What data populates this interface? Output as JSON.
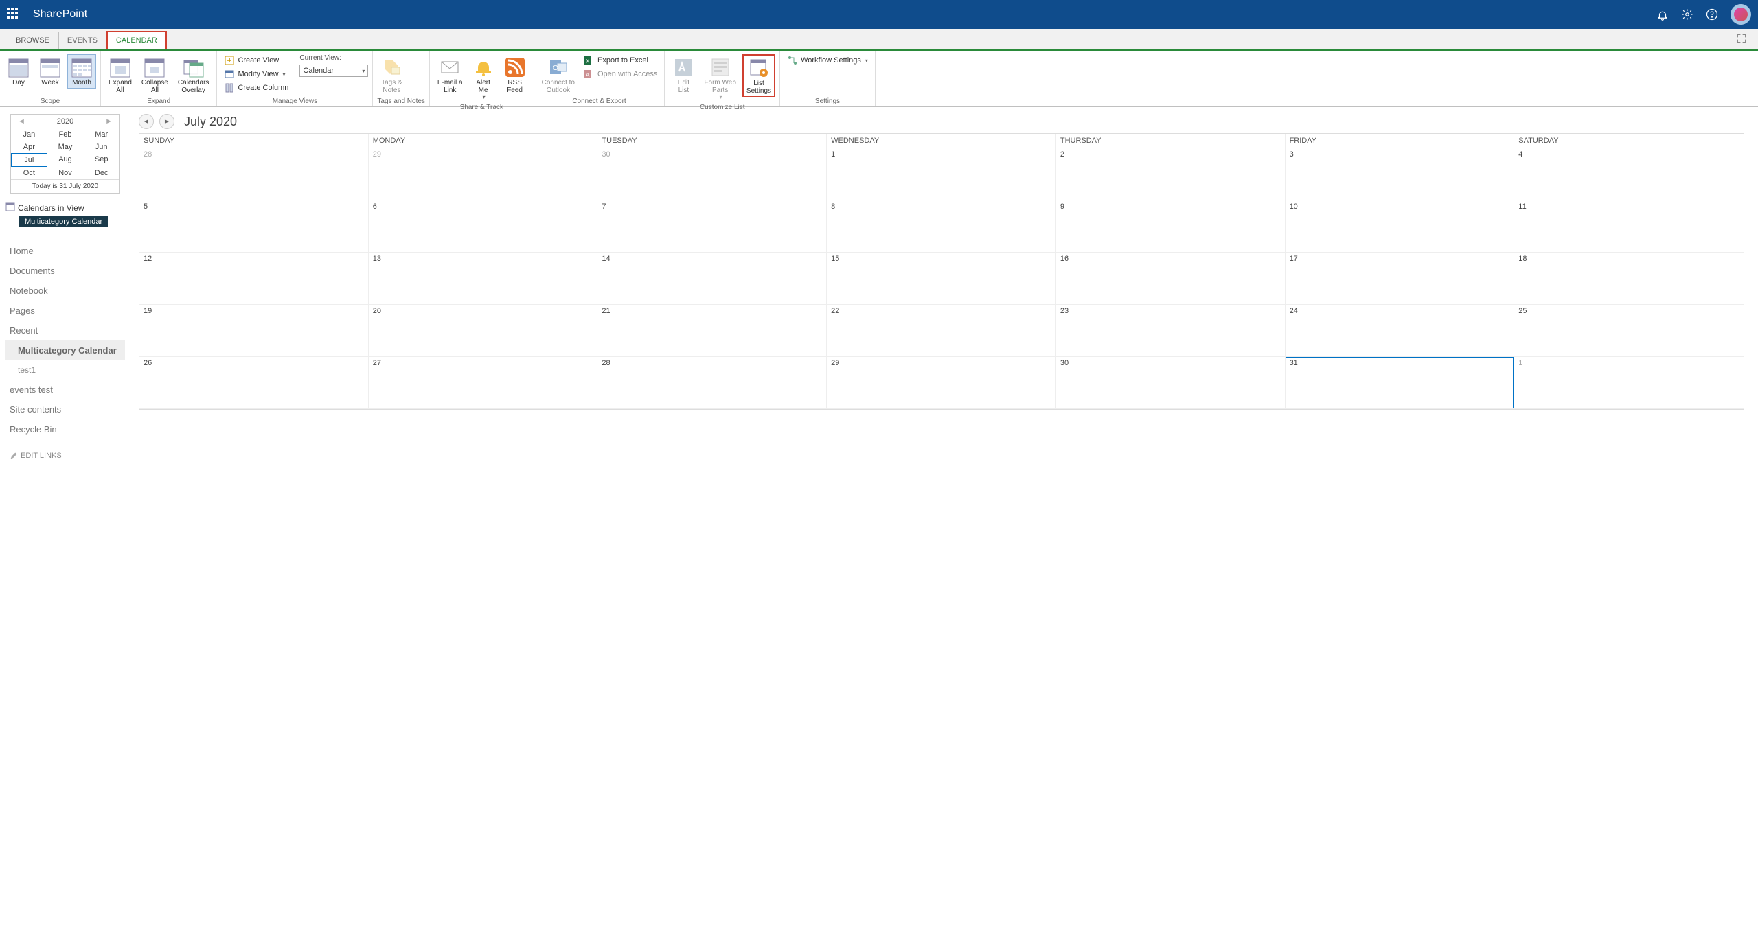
{
  "topbar": {
    "brand": "SharePoint"
  },
  "tabs": {
    "browse": "BROWSE",
    "events": "EVENTS",
    "calendar": "CALENDAR"
  },
  "ribbon": {
    "groups": {
      "scope": {
        "label": "Scope",
        "day": "Day",
        "week": "Week",
        "month": "Month"
      },
      "expand": {
        "label": "Expand",
        "expand_all": "Expand\nAll",
        "collapse_all": "Collapse\nAll",
        "overlay": "Calendars\nOverlay"
      },
      "manage_views": {
        "label": "Manage Views",
        "create_view": "Create View",
        "modify_view": "Modify View",
        "create_column": "Create Column",
        "current_view_label": "Current View:",
        "current_view_value": "Calendar"
      },
      "tags_notes": {
        "label": "Tags and Notes",
        "tags": "Tags &\nNotes"
      },
      "share_track": {
        "label": "Share & Track",
        "email": "E-mail a\nLink",
        "alert": "Alert\nMe",
        "rss": "RSS\nFeed"
      },
      "connect_export": {
        "label": "Connect & Export",
        "connect_outlook": "Connect to\nOutlook",
        "export_excel": "Export to Excel",
        "open_access": "Open with Access"
      },
      "customize": {
        "label": "Customize List",
        "edit_list": "Edit\nList",
        "form_parts": "Form Web\nParts",
        "list_settings": "List\nSettings"
      },
      "settings": {
        "label": "Settings",
        "workflow": "Workflow Settings"
      }
    }
  },
  "mini_calendar": {
    "year": "2020",
    "months": [
      "Jan",
      "Feb",
      "Mar",
      "Apr",
      "May",
      "Jun",
      "Jul",
      "Aug",
      "Sep",
      "Oct",
      "Nov",
      "Dec"
    ],
    "selected_month_index": 6,
    "today_text": "Today is 31 July 2020"
  },
  "calendars_in_view": {
    "header": "Calendars in View",
    "chip": "Multicategory Calendar"
  },
  "leftnav": {
    "items": [
      "Home",
      "Documents",
      "Notebook",
      "Pages",
      "Recent"
    ],
    "subitems": [
      "Multicategory Calendar",
      "test1"
    ],
    "items_after": [
      "events test",
      "Site contents",
      "Recycle Bin"
    ],
    "edit_links": "EDIT LINKS"
  },
  "calendar": {
    "title": "July 2020",
    "day_headers": [
      "SUNDAY",
      "MONDAY",
      "TUESDAY",
      "WEDNESDAY",
      "THURSDAY",
      "FRIDAY",
      "SATURDAY"
    ],
    "weeks": [
      [
        {
          "n": "28",
          "other": true
        },
        {
          "n": "29",
          "other": true
        },
        {
          "n": "30",
          "other": true
        },
        {
          "n": "1"
        },
        {
          "n": "2"
        },
        {
          "n": "3"
        },
        {
          "n": "4"
        }
      ],
      [
        {
          "n": "5"
        },
        {
          "n": "6"
        },
        {
          "n": "7"
        },
        {
          "n": "8"
        },
        {
          "n": "9"
        },
        {
          "n": "10"
        },
        {
          "n": "11"
        }
      ],
      [
        {
          "n": "12"
        },
        {
          "n": "13"
        },
        {
          "n": "14"
        },
        {
          "n": "15"
        },
        {
          "n": "16"
        },
        {
          "n": "17"
        },
        {
          "n": "18"
        }
      ],
      [
        {
          "n": "19"
        },
        {
          "n": "20"
        },
        {
          "n": "21"
        },
        {
          "n": "22"
        },
        {
          "n": "23"
        },
        {
          "n": "24"
        },
        {
          "n": "25"
        }
      ],
      [
        {
          "n": "26"
        },
        {
          "n": "27"
        },
        {
          "n": "28"
        },
        {
          "n": "29"
        },
        {
          "n": "30"
        },
        {
          "n": "31",
          "today": true
        },
        {
          "n": "1",
          "other": true
        }
      ]
    ]
  }
}
